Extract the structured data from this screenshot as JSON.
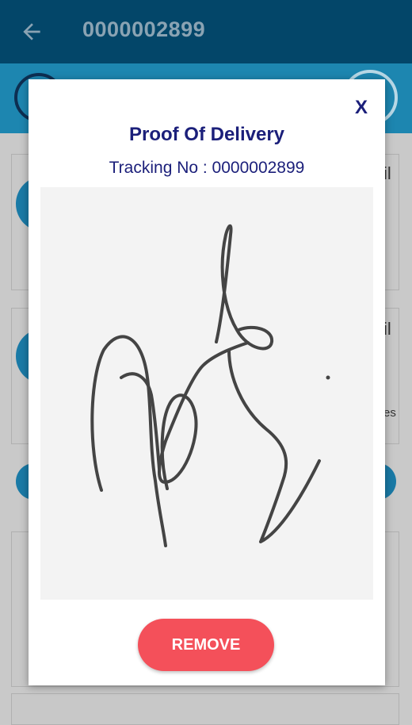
{
  "appbar": {
    "title": "0000002899",
    "back_icon": "arrow-left-icon"
  },
  "background": {
    "text_partial_1": "il",
    "text_partial_2": "il",
    "text_partial_3": "es"
  },
  "dialog": {
    "close_label": "X",
    "title": "Proof Of Delivery",
    "tracking_text": "Tracking No : 0000002899",
    "remove_label": "REMOVE"
  },
  "colors": {
    "appbar": "#034669",
    "title_text": "#1b1f7a",
    "remove_button": "#f4505a",
    "signature_pad": "#f3f3f3"
  }
}
